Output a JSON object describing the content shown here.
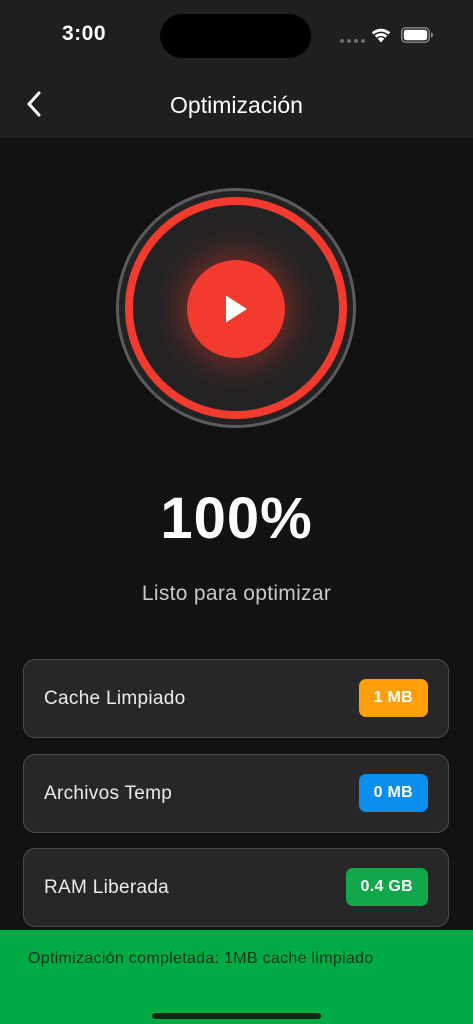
{
  "status_bar": {
    "time": "3:00",
    "wifi_icon": "wifi-icon",
    "battery_icon": "battery-icon"
  },
  "nav": {
    "title": "Optimización",
    "back_icon": "chevron-left-icon"
  },
  "dial": {
    "icon": "play-icon",
    "ring_color": "#f23a2f",
    "progress_percent": 100
  },
  "progress": {
    "percent": "100%",
    "status": "Listo para optimizar"
  },
  "stats": [
    {
      "label": "Cache Limpiado",
      "value": "1 MB",
      "color": "#ff9f0a"
    },
    {
      "label": "Archivos Temp",
      "value": "0 MB",
      "color": "#0a8ff0"
    },
    {
      "label": "RAM Liberada",
      "value": "0.4 GB",
      "color": "#10a84a"
    }
  ],
  "toast": {
    "message": "Optimización completada: 1MB cache limpiado",
    "color": "#00aa44"
  }
}
